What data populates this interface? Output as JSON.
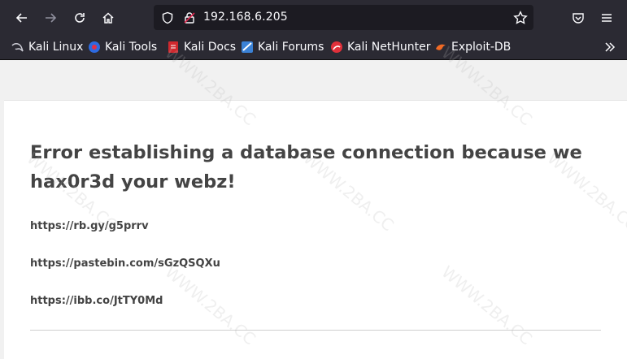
{
  "browser": {
    "url": "192.168.6.205",
    "bookmarks": [
      {
        "label": "Kali Linux",
        "icon": "kali-dragon-icon"
      },
      {
        "label": "Kali Tools",
        "icon": "kali-tools-icon"
      },
      {
        "label": "Kali Docs",
        "icon": "kali-docs-icon"
      },
      {
        "label": "Kali Forums",
        "icon": "kali-forums-icon"
      },
      {
        "label": "Kali NetHunter",
        "icon": "kali-nethunter-icon"
      },
      {
        "label": "Exploit-DB",
        "icon": "exploit-db-icon"
      }
    ]
  },
  "page": {
    "error_title": "Error establishing a database connection because we hax0r3d your webz!",
    "links": [
      "https://rb.gy/g5prrv",
      "https://pastebin.com/sGzQSQXu",
      "https://ibb.co/JtTY0Md"
    ]
  },
  "watermark": "WWW.2BA.CC"
}
